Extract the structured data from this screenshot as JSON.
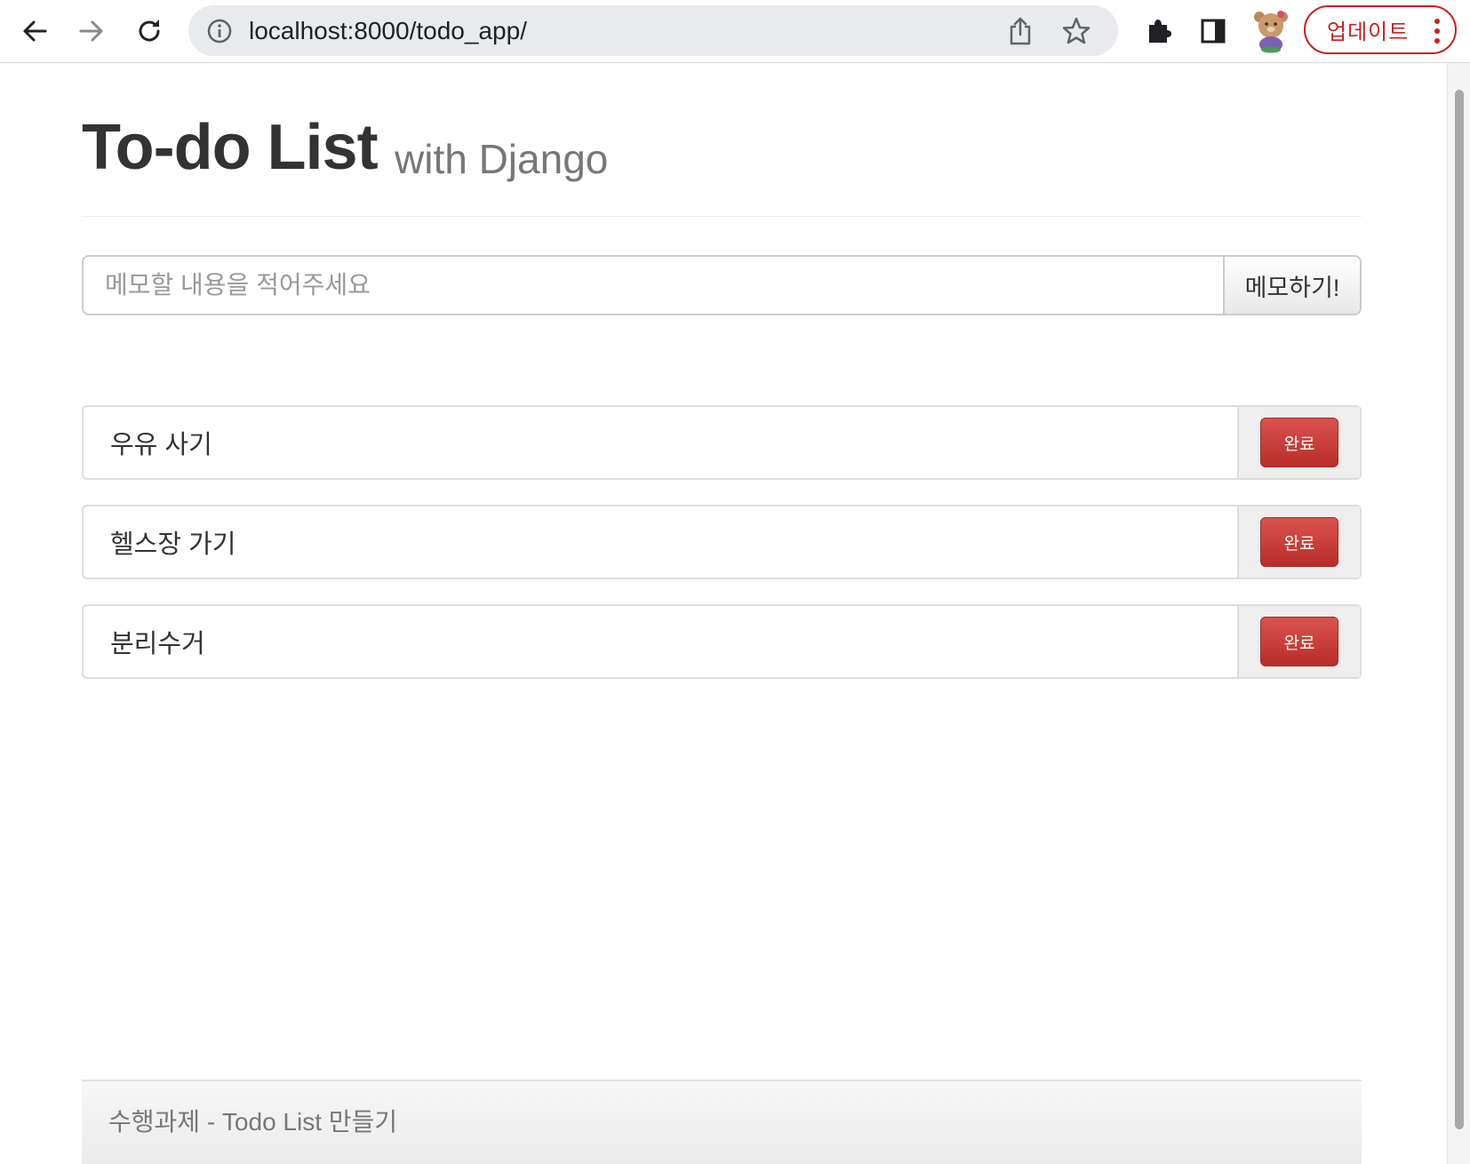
{
  "browser": {
    "url": "localhost:8000/todo_app/",
    "update_label": "업데이트"
  },
  "page": {
    "title": "To-do List",
    "subtitle": "with Django"
  },
  "memo_form": {
    "placeholder": "메모할 내용을 적어주세요",
    "submit_label": "메모하기!"
  },
  "todos": [
    {
      "text": "우유 사기",
      "action": "완료"
    },
    {
      "text": "헬스장 가기",
      "action": "완료"
    },
    {
      "text": "분리수거",
      "action": "완료"
    }
  ],
  "footer": {
    "text": "수행과제 - Todo List 만들기"
  },
  "colors": {
    "danger": "#d9534f",
    "update_accent": "#c5221f"
  }
}
